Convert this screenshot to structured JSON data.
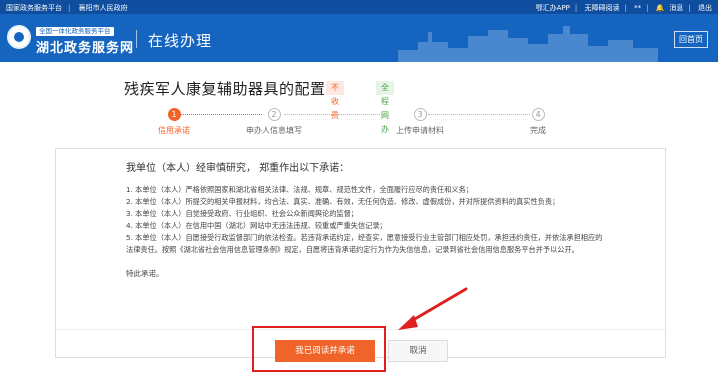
{
  "topbar": {
    "gov_link": "国家政务服务平台",
    "city_link": "襄阳市人民政府",
    "app_link": "鄂汇办APP",
    "accessibility": "无障碍阅读",
    "user": "**",
    "messages": "消息",
    "logout": "退出"
  },
  "header": {
    "brand_sub": "全国一体化政务服务平台",
    "brand_main": "湖北政务服务网",
    "page_title": "在线办理",
    "home_button": "回首页"
  },
  "service": {
    "title": "残疾军人康复辅助器具的配置",
    "fee_badge": "不收费",
    "online_badge": "全程网办"
  },
  "steps": [
    {
      "number": "1",
      "label": "信用承诺",
      "active": true
    },
    {
      "number": "2",
      "label": "申办人信息填写",
      "active": false
    },
    {
      "number": "3",
      "label": "上传申请材料",
      "active": false
    },
    {
      "number": "4",
      "label": "完成",
      "active": false
    }
  ],
  "commitment": {
    "heading": "我单位（本人）经审慎研究， 郑重作出以下承诺：",
    "items": [
      "1. 本单位（本人）严格依照国家和湖北省相关法律、法规、规章、规范性文件，全面履行应尽的责任和义务；",
      "2. 本单位（本人）所提交的相关申报材料，均合法、真实、准确、有效，无任何伪造、修改、虚假成份，并对所提供资料的真实性负责；",
      "3. 本单位（本人）自觉接受政府、行业组织、社会公众新闻舆论的监督；",
      "4. 本单位（本人）在信用中国（湖北）网站中无违法违规、较重或严重失信记录；",
      "5. 本单位（本人）自愿接受行政监督部门的依法检查。若违背承诺约定，经查实，愿意接受行业主管部门相应处罚，承担违约责任，并依法承担相应的法律责任。按照《湖北省社会信用信息管理条例》规定，自愿将违背承诺约定行为作为失信信息，记录到省社会信用信息服务平台并予以公开。"
    ],
    "closing": "特此承诺。"
  },
  "buttons": {
    "confirm": "我已阅读并承诺",
    "cancel": "取消"
  },
  "colors": {
    "header_blue": "#1565c0",
    "topbar_blue": "#0f4d9e",
    "accent_orange": "#f0642a",
    "annotation_red": "#e02020"
  }
}
